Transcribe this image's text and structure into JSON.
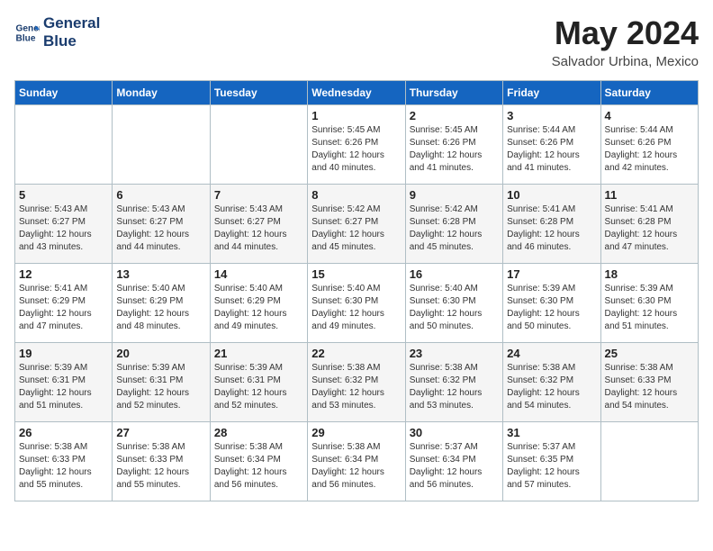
{
  "header": {
    "logo_line1": "General",
    "logo_line2": "Blue",
    "month_year": "May 2024",
    "location": "Salvador Urbina, Mexico"
  },
  "weekdays": [
    "Sunday",
    "Monday",
    "Tuesday",
    "Wednesday",
    "Thursday",
    "Friday",
    "Saturday"
  ],
  "weeks": [
    [
      {
        "day": "",
        "info": ""
      },
      {
        "day": "",
        "info": ""
      },
      {
        "day": "",
        "info": ""
      },
      {
        "day": "1",
        "info": "Sunrise: 5:45 AM\nSunset: 6:26 PM\nDaylight: 12 hours\nand 40 minutes."
      },
      {
        "day": "2",
        "info": "Sunrise: 5:45 AM\nSunset: 6:26 PM\nDaylight: 12 hours\nand 41 minutes."
      },
      {
        "day": "3",
        "info": "Sunrise: 5:44 AM\nSunset: 6:26 PM\nDaylight: 12 hours\nand 41 minutes."
      },
      {
        "day": "4",
        "info": "Sunrise: 5:44 AM\nSunset: 6:26 PM\nDaylight: 12 hours\nand 42 minutes."
      }
    ],
    [
      {
        "day": "5",
        "info": "Sunrise: 5:43 AM\nSunset: 6:27 PM\nDaylight: 12 hours\nand 43 minutes."
      },
      {
        "day": "6",
        "info": "Sunrise: 5:43 AM\nSunset: 6:27 PM\nDaylight: 12 hours\nand 44 minutes."
      },
      {
        "day": "7",
        "info": "Sunrise: 5:43 AM\nSunset: 6:27 PM\nDaylight: 12 hours\nand 44 minutes."
      },
      {
        "day": "8",
        "info": "Sunrise: 5:42 AM\nSunset: 6:27 PM\nDaylight: 12 hours\nand 45 minutes."
      },
      {
        "day": "9",
        "info": "Sunrise: 5:42 AM\nSunset: 6:28 PM\nDaylight: 12 hours\nand 45 minutes."
      },
      {
        "day": "10",
        "info": "Sunrise: 5:41 AM\nSunset: 6:28 PM\nDaylight: 12 hours\nand 46 minutes."
      },
      {
        "day": "11",
        "info": "Sunrise: 5:41 AM\nSunset: 6:28 PM\nDaylight: 12 hours\nand 47 minutes."
      }
    ],
    [
      {
        "day": "12",
        "info": "Sunrise: 5:41 AM\nSunset: 6:29 PM\nDaylight: 12 hours\nand 47 minutes."
      },
      {
        "day": "13",
        "info": "Sunrise: 5:40 AM\nSunset: 6:29 PM\nDaylight: 12 hours\nand 48 minutes."
      },
      {
        "day": "14",
        "info": "Sunrise: 5:40 AM\nSunset: 6:29 PM\nDaylight: 12 hours\nand 49 minutes."
      },
      {
        "day": "15",
        "info": "Sunrise: 5:40 AM\nSunset: 6:30 PM\nDaylight: 12 hours\nand 49 minutes."
      },
      {
        "day": "16",
        "info": "Sunrise: 5:40 AM\nSunset: 6:30 PM\nDaylight: 12 hours\nand 50 minutes."
      },
      {
        "day": "17",
        "info": "Sunrise: 5:39 AM\nSunset: 6:30 PM\nDaylight: 12 hours\nand 50 minutes."
      },
      {
        "day": "18",
        "info": "Sunrise: 5:39 AM\nSunset: 6:30 PM\nDaylight: 12 hours\nand 51 minutes."
      }
    ],
    [
      {
        "day": "19",
        "info": "Sunrise: 5:39 AM\nSunset: 6:31 PM\nDaylight: 12 hours\nand 51 minutes."
      },
      {
        "day": "20",
        "info": "Sunrise: 5:39 AM\nSunset: 6:31 PM\nDaylight: 12 hours\nand 52 minutes."
      },
      {
        "day": "21",
        "info": "Sunrise: 5:39 AM\nSunset: 6:31 PM\nDaylight: 12 hours\nand 52 minutes."
      },
      {
        "day": "22",
        "info": "Sunrise: 5:38 AM\nSunset: 6:32 PM\nDaylight: 12 hours\nand 53 minutes."
      },
      {
        "day": "23",
        "info": "Sunrise: 5:38 AM\nSunset: 6:32 PM\nDaylight: 12 hours\nand 53 minutes."
      },
      {
        "day": "24",
        "info": "Sunrise: 5:38 AM\nSunset: 6:32 PM\nDaylight: 12 hours\nand 54 minutes."
      },
      {
        "day": "25",
        "info": "Sunrise: 5:38 AM\nSunset: 6:33 PM\nDaylight: 12 hours\nand 54 minutes."
      }
    ],
    [
      {
        "day": "26",
        "info": "Sunrise: 5:38 AM\nSunset: 6:33 PM\nDaylight: 12 hours\nand 55 minutes."
      },
      {
        "day": "27",
        "info": "Sunrise: 5:38 AM\nSunset: 6:33 PM\nDaylight: 12 hours\nand 55 minutes."
      },
      {
        "day": "28",
        "info": "Sunrise: 5:38 AM\nSunset: 6:34 PM\nDaylight: 12 hours\nand 56 minutes."
      },
      {
        "day": "29",
        "info": "Sunrise: 5:38 AM\nSunset: 6:34 PM\nDaylight: 12 hours\nand 56 minutes."
      },
      {
        "day": "30",
        "info": "Sunrise: 5:37 AM\nSunset: 6:34 PM\nDaylight: 12 hours\nand 56 minutes."
      },
      {
        "day": "31",
        "info": "Sunrise: 5:37 AM\nSunset: 6:35 PM\nDaylight: 12 hours\nand 57 minutes."
      },
      {
        "day": "",
        "info": ""
      }
    ]
  ]
}
